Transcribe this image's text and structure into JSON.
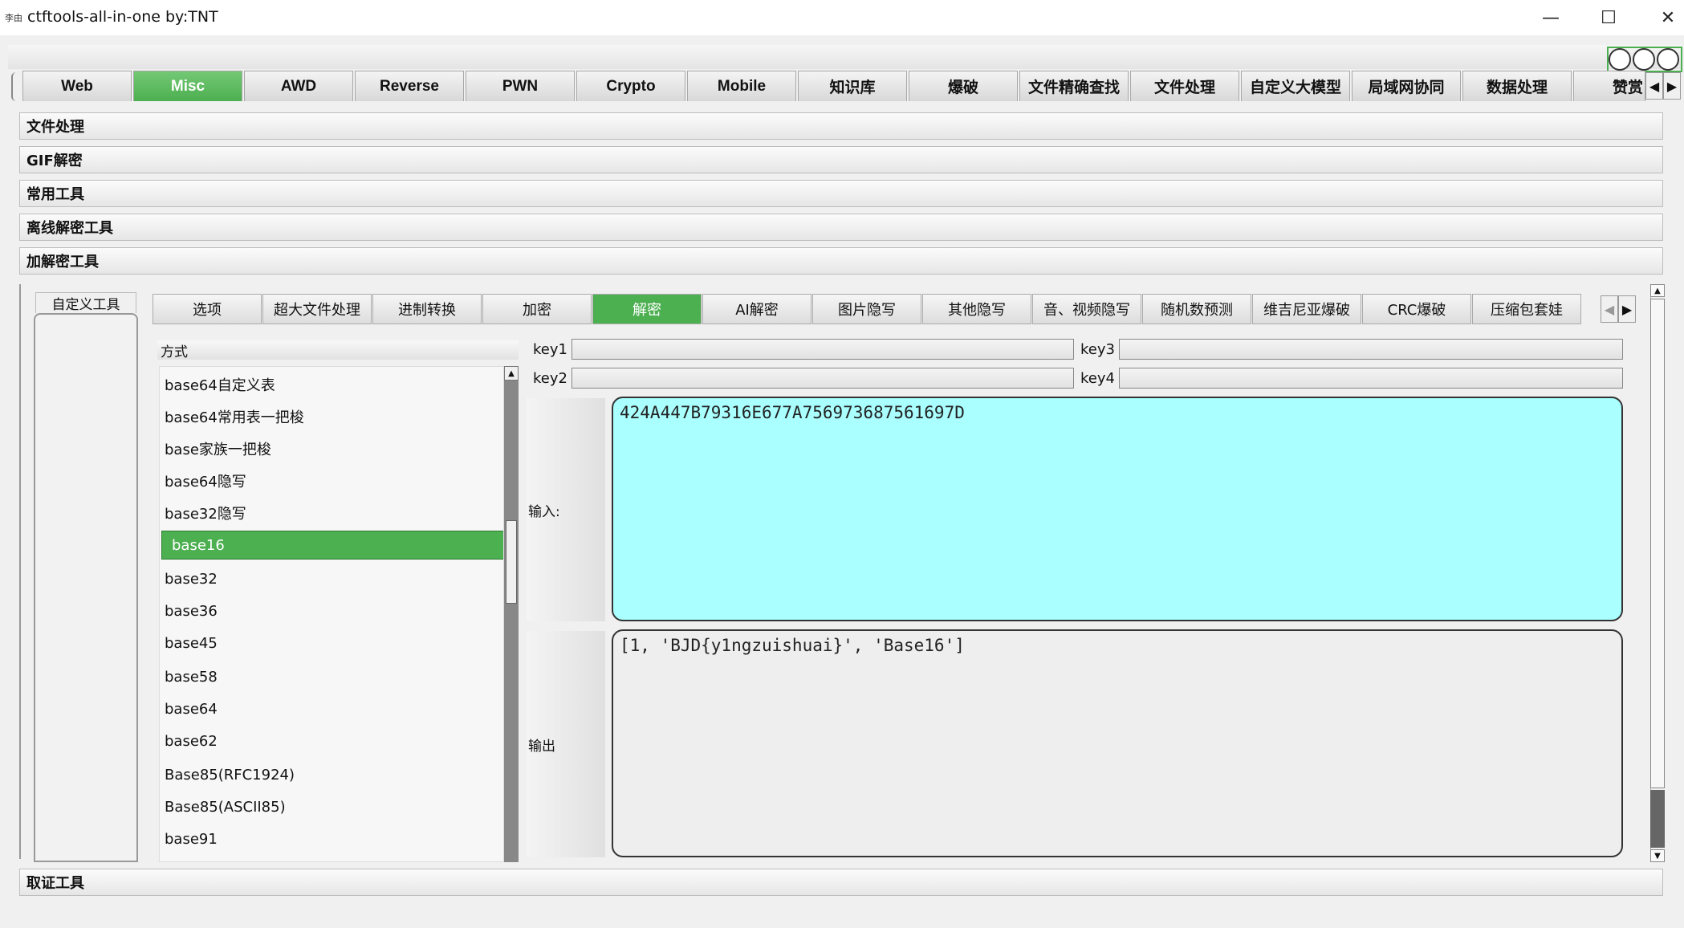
{
  "window": {
    "icon_text": "李由",
    "title": "ctftools-all-in-one   by:TNT",
    "minimize": "—",
    "maximize": "☐",
    "close": "✕"
  },
  "main_tabs": [
    "Web",
    "Misc",
    "AWD",
    "Reverse",
    "PWN",
    "Crypto",
    "Mobile",
    "知识库",
    "爆破",
    "文件精确查找",
    "文件处理",
    "自定义大模型",
    "局域网协同",
    "数据处理",
    "赞赏"
  ],
  "main_tabs_active": "Misc",
  "sections_top": [
    "文件处理",
    "GIF解密",
    "常用工具",
    "离线解密工具",
    "加解密工具"
  ],
  "section_bottom": "取证工具",
  "side_tab": "自定义工具",
  "sub_tabs": [
    "选项",
    "超大文件处理",
    "进制转换",
    "加密",
    "解密",
    "AI解密",
    "图片隐写",
    "其他隐写",
    "音、视频隐写",
    "随机数预测",
    "维吉尼亚爆破",
    "CRC爆破",
    "压缩包套娃"
  ],
  "sub_tabs_active": "解密",
  "method_header": "方式",
  "methods": [
    "base64自定义表",
    "base64常用表一把梭",
    "base家族一把梭",
    "base64隐写",
    "base32隐写",
    "base16",
    "base32",
    "base36",
    "base45",
    "base58",
    "base64",
    "base62",
    "Base85(RFC1924)",
    "Base85(ASCII85)",
    "base91"
  ],
  "method_selected": "base16",
  "keys": {
    "key1": "key1",
    "key2": "key2",
    "key3": "key3",
    "key4": "key4"
  },
  "input_label": "输入:",
  "output_label": "输出",
  "input_value": "424A447B79316E677A756973687561697D",
  "output_value": "[1, 'BJD{y1ngzuishuai}', 'Base16']",
  "colors": {
    "accent": "#4caf50",
    "input_bg": "#aaffff",
    "output_bg": "#eeeeee"
  },
  "icons": {
    "left_arrow": "◀",
    "right_arrow": "▶",
    "up_arrow": "▲",
    "down_arrow": "▼"
  }
}
